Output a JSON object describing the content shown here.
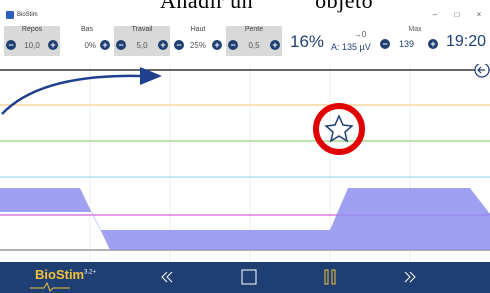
{
  "caption": {
    "word1": "Añadir un",
    "word2": "objeto"
  },
  "window": {
    "title": "BioStim",
    "controls": [
      "–",
      "□",
      "×"
    ]
  },
  "params": [
    {
      "label": "Repos",
      "value": "10,0"
    },
    {
      "label": "Bas",
      "value": "0%"
    },
    {
      "label": "Travail",
      "value": "5,0"
    },
    {
      "label": "Haut",
      "value": "25%"
    },
    {
      "label": "Pente",
      "value": "0,5"
    }
  ],
  "status": {
    "percent": "16%",
    "amp_arrow": "→0",
    "amplitude": "A: 135 µV",
    "max_label": "Max",
    "max_value": "139",
    "time": "19:20"
  },
  "graph": {
    "line_colors": [
      "#333333",
      "#f5c26b",
      "#7ac75a",
      "#8ed0e8",
      "#d23ad2",
      "#999999"
    ],
    "signal_color": "#8f8ff0",
    "arrow_color": "#1f3f8f",
    "highlight_color": "#e00000",
    "star_icon": "star-outline-icon"
  },
  "bottombar": {
    "logo": "BioStim",
    "logo_superscript": "3.2+",
    "buttons": [
      "rewind",
      "stop",
      "pause",
      "fast-forward"
    ]
  }
}
